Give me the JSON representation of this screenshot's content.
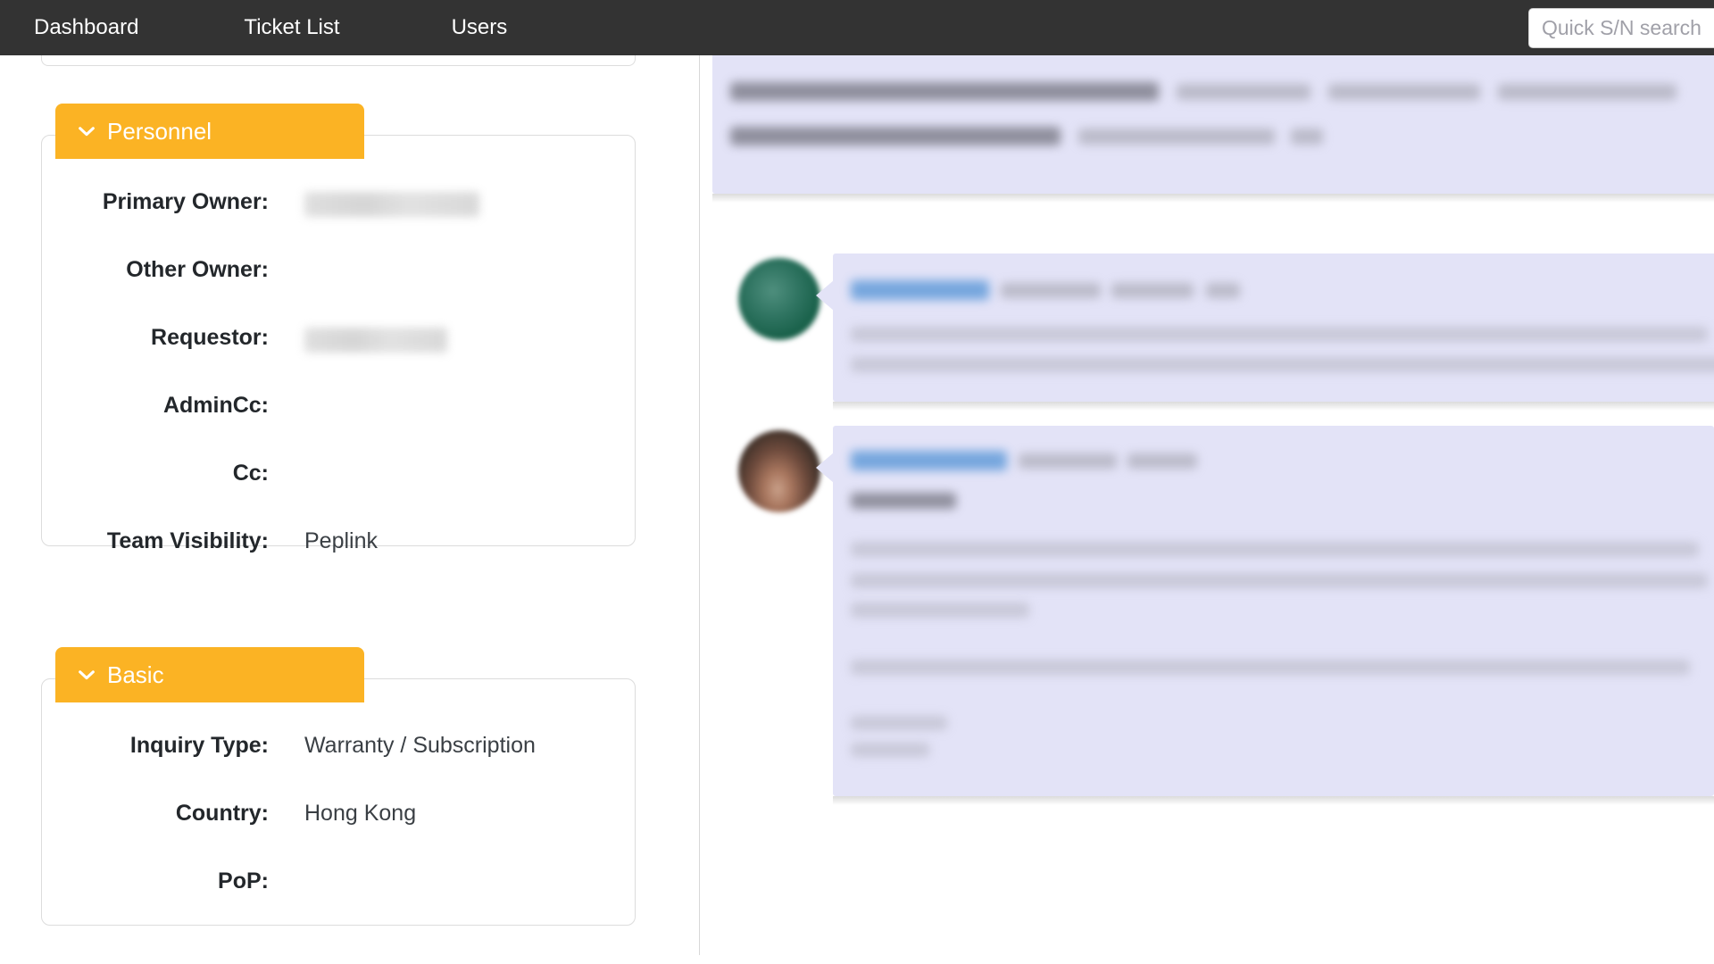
{
  "nav": {
    "links": [
      {
        "label": "Dashboard"
      },
      {
        "label": "Ticket List"
      },
      {
        "label": "Users"
      }
    ],
    "search": {
      "placeholder": "Quick S/N search",
      "value": ""
    }
  },
  "colors": {
    "navbar_background": "#333333",
    "section_tab_accent": "#fbb324",
    "bubble_background": "#e3e3f7",
    "card_border": "#dcdcdc",
    "label_text": "#23272b",
    "value_text": "#3a3f44",
    "avatar_green": "#186049"
  },
  "sidebar": {
    "sections": [
      {
        "id": "personnel",
        "title": "Personnel",
        "collapse_icon": "chevron-down-icon",
        "expanded": true,
        "fields": [
          {
            "label": "Primary Owner:",
            "value": "",
            "redacted": true
          },
          {
            "label": "Other Owner:",
            "value": "",
            "redacted": false
          },
          {
            "label": "Requestor:",
            "value": "",
            "redacted": true
          },
          {
            "label": "AdminCc:",
            "value": "",
            "redacted": false
          },
          {
            "label": "Cc:",
            "value": "",
            "redacted": false
          },
          {
            "label": "Team Visibility:",
            "value": "Peplink",
            "redacted": false
          }
        ]
      },
      {
        "id": "basic",
        "title": "Basic",
        "collapse_icon": "chevron-down-icon",
        "expanded": true,
        "fields": [
          {
            "label": "Inquiry Type:",
            "value": "Warranty / Subscription",
            "redacted": false
          },
          {
            "label": "Country:",
            "value": "Hong Kong",
            "redacted": false
          },
          {
            "label": "PoP:",
            "value": "",
            "redacted": false
          }
        ]
      }
    ]
  },
  "conversation": {
    "messages": [
      {
        "id": "msg-top",
        "avatar": "none",
        "author": "",
        "meta": "",
        "body_redacted": true
      },
      {
        "id": "msg-second",
        "avatar": "green-circle-avatar",
        "author": "",
        "meta": "",
        "body_redacted": true
      },
      {
        "id": "msg-third",
        "avatar": "photo-avatar",
        "author": "",
        "meta": "",
        "body_redacted": true
      }
    ]
  }
}
